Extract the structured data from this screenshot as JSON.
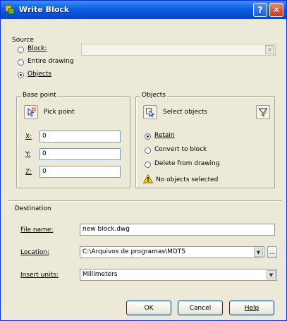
{
  "window": {
    "title": "Write Block",
    "help_glyph": "?",
    "close_glyph": "✕"
  },
  "source": {
    "label": "Source",
    "options": [
      {
        "text": "Block:",
        "selected": false
      },
      {
        "text": "Entire drawing",
        "selected": false
      },
      {
        "text": "Objects",
        "selected": true
      }
    ],
    "block_value": ""
  },
  "base_point": {
    "label": "Base point",
    "pick_label": "Pick point",
    "x_label": "X:",
    "x_value": "0",
    "y_label": "Y:",
    "y_value": "0",
    "z_label": "Z:",
    "z_value": "0"
  },
  "objects": {
    "label": "Objects",
    "select_label": "Select objects",
    "options": [
      {
        "text": "Retain",
        "selected": true
      },
      {
        "text": "Convert to block",
        "selected": false
      },
      {
        "text": "Delete from drawing",
        "selected": false
      }
    ],
    "status": "No objects selected"
  },
  "destination": {
    "label": "Destination",
    "file_label": "File name:",
    "file_value": "new block.dwg",
    "location_label": "Location:",
    "location_value": "C:\\Arquivos de programas\\MDT5",
    "browse_label": "...",
    "units_label": "Insert units:",
    "units_value": "Millimeters"
  },
  "buttons": {
    "ok": "OK",
    "cancel": "Cancel",
    "help": "Help"
  },
  "colors": {
    "title_bar": "#0a5fe0",
    "dialog_bg": "#ece9d8",
    "warning": "#f5d20a"
  }
}
